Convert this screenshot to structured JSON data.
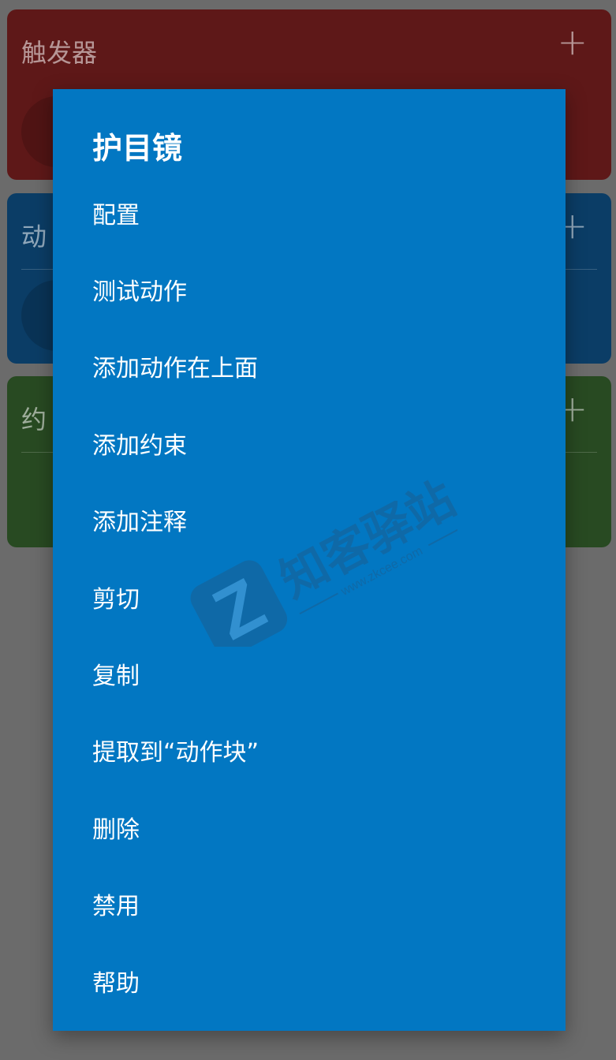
{
  "background": {
    "cards": [
      {
        "title": "触发器",
        "plus": "+",
        "color": "#5e1818"
      },
      {
        "title": "动",
        "plus": "+",
        "color": "#0b3d66"
      },
      {
        "title": "约",
        "plus": "+",
        "color": "#284a22"
      }
    ]
  },
  "dialog": {
    "title": "护目镜",
    "background": "#0277c2",
    "items": [
      {
        "label": "配置"
      },
      {
        "label": "测试动作"
      },
      {
        "label": "添加动作在上面"
      },
      {
        "label": "添加约束"
      },
      {
        "label": "添加注释"
      },
      {
        "label": "剪切"
      },
      {
        "label": "复制"
      },
      {
        "label": "提取到“动作块”"
      },
      {
        "label": "删除"
      },
      {
        "label": "禁用"
      },
      {
        "label": "帮助"
      }
    ]
  },
  "watermark": {
    "logo_letter": "Z",
    "text": "知客驿站",
    "url": "www.zkcee.com"
  }
}
